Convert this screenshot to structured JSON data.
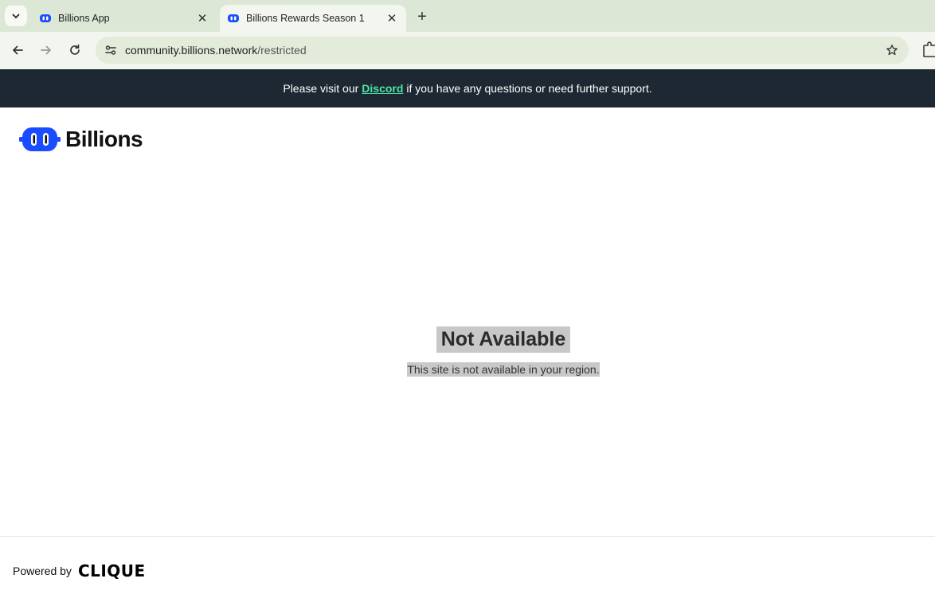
{
  "browser": {
    "tabs": [
      {
        "title": "Billions App",
        "active": false
      },
      {
        "title": "Billions Rewards Season 1",
        "active": true
      }
    ],
    "new_tab_label": "+",
    "close_label": "✕",
    "url_host": "community.billions.network",
    "url_path": "/restricted"
  },
  "banner": {
    "prefix": "Please visit our",
    "link_label": "Discord",
    "suffix": "if you have any questions or need further support."
  },
  "logo": {
    "wordmark": "Billions"
  },
  "main": {
    "title": "Not Available",
    "message": "This site is not available in your region."
  },
  "footer": {
    "powered_by": "Powered by",
    "brand": "CLIQUE"
  },
  "colors": {
    "brand_blue": "#1a4dff",
    "banner_bg": "#1d2833",
    "link_green": "#4ee3a4",
    "highlight": "#c8c8c8"
  }
}
